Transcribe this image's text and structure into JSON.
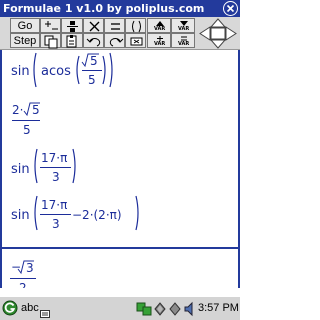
{
  "window": {
    "title": "Formulae 1 v1.0 by poliplus.com"
  },
  "toolbar": {
    "go_label": "Go",
    "step_label": "Step",
    "var_label": "VAR",
    "colors": {
      "bar": "#d8d8d8",
      "button": "#e8e8e8"
    }
  },
  "math": {
    "color": "#1c2d9a",
    "expr1": {
      "func_outer": "sin",
      "func_inner": "acos",
      "radicand": "5",
      "denominator": "5"
    },
    "expr2": {
      "coefficient": "2·",
      "radicand": "5",
      "denominator": "5"
    },
    "expr3": {
      "func": "sin",
      "numerator": "17·π",
      "denominator": "3"
    },
    "expr4": {
      "func": "sin",
      "numerator": "17·π",
      "denominator": "3",
      "tail": "−2·(2·π)"
    },
    "result": {
      "sign": "−",
      "radicand": "3",
      "denominator": "2"
    }
  },
  "taskbar": {
    "input_label": "abc",
    "clock": "3:57 PM"
  },
  "icons": {
    "start": "g-start-icon",
    "keyboard": "keyboard-input-icon",
    "network": "network-icon",
    "battery": "battery-icon",
    "speaker": "speaker-icon"
  },
  "colors": {
    "titlebar": "#233a9c",
    "math_text": "#1c2d9a",
    "taskbar": "#d4d4d4"
  }
}
